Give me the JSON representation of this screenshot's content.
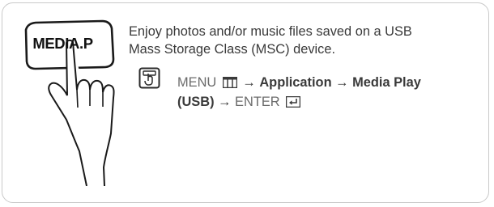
{
  "button": {
    "label": "MEDIA.P",
    "hand_icon": "pointing-hand-icon"
  },
  "description": {
    "line1": "Enjoy photos and/or music files saved on a USB",
    "line2": "Mass Storage Class (MSC) device."
  },
  "instruction": {
    "remote_icon": "remote-hand-icon",
    "menu_label": "MENU",
    "menu_icon": "menu-grid-icon",
    "arrow": "→",
    "step1": "Application",
    "step2_a": "Media Play",
    "step2_b": "(USB)",
    "enter_label": "ENTER",
    "enter_icon": "enter-return-icon"
  }
}
